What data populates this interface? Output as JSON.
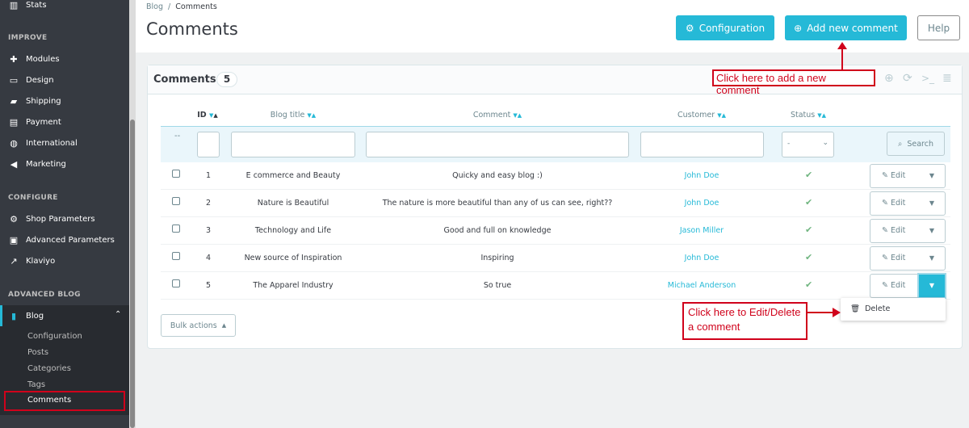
{
  "sidebar": {
    "stats": "Stats",
    "improve": "IMPROVE",
    "improve_items": [
      "Modules",
      "Design",
      "Shipping",
      "Payment",
      "International",
      "Marketing"
    ],
    "configure": "CONFIGURE",
    "configure_items": [
      "Shop Parameters",
      "Advanced Parameters",
      "Klaviyo"
    ],
    "advanced_blog": "ADVANCED BLOG",
    "blog": "Blog",
    "blog_sub": [
      "Configuration",
      "Posts",
      "Categories",
      "Tags",
      "Comments"
    ],
    "active": "Comments"
  },
  "header": {
    "breadcrumb": [
      "Blog",
      "Comments"
    ],
    "title": "Comments",
    "buttons": {
      "configuration": "Configuration",
      "add": "Add new comment",
      "help": "Help"
    }
  },
  "card": {
    "title": "Comments",
    "count": "5",
    "columns": [
      "ID",
      "Blog title",
      "Comment",
      "Customer",
      "Status"
    ],
    "filter": {
      "dash": "--",
      "status_value": "-",
      "search": "Search"
    },
    "rows": [
      {
        "id": "1",
        "blog": "E commerce and Beauty",
        "comment": "Quicky and easy blog :)",
        "customer": "John Doe"
      },
      {
        "id": "2",
        "blog": "Nature is Beautiful",
        "comment": "The nature is more beautiful than any of us can see, right??",
        "customer": "John Doe"
      },
      {
        "id": "3",
        "blog": "Technology and Life",
        "comment": "Good and full on knowledge",
        "customer": "Jason Miller"
      },
      {
        "id": "4",
        "blog": "New source of Inspiration",
        "comment": "Inspiring",
        "customer": "John Doe"
      },
      {
        "id": "5",
        "blog": "The Apparel Industry",
        "comment": "So true",
        "customer": "Michael Anderson"
      }
    ],
    "edit": "Edit",
    "delete": "Delete",
    "bulk": "Bulk actions"
  },
  "annotations": {
    "add": "Click here to add a new comment",
    "edit": "Click here to Edit/Delete a comment"
  },
  "colors": {
    "accent": "#25b9d7",
    "sidebar": "#363a41",
    "annotation": "#d0021b",
    "status_ok": "#70b580"
  }
}
